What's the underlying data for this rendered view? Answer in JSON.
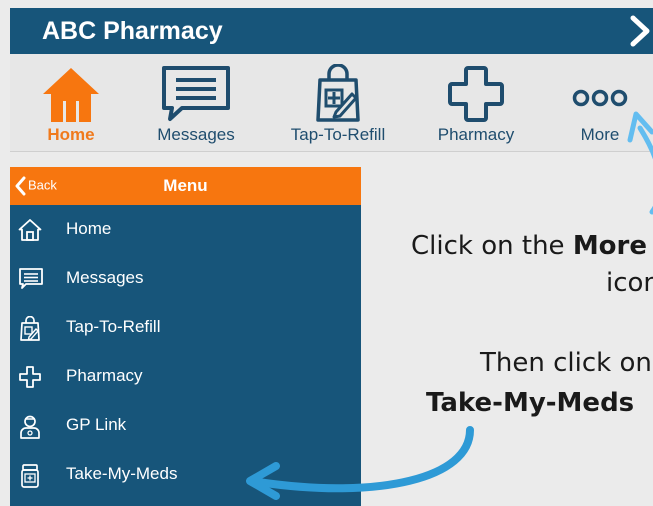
{
  "app": {
    "title": "ABC Pharmacy",
    "header_color": "#17557a",
    "accent_color": "#f7760f"
  },
  "navbar": {
    "items": [
      {
        "label": "Home",
        "icon": "home-icon",
        "active": true
      },
      {
        "label": "Messages",
        "icon": "messages-icon",
        "active": false
      },
      {
        "label": "Tap-To-Refill",
        "icon": "refill-bag-icon",
        "active": false
      },
      {
        "label": "Pharmacy",
        "icon": "pharmacy-cross-icon",
        "active": false
      },
      {
        "label": "More",
        "icon": "more-dots-icon",
        "active": false
      }
    ]
  },
  "menu": {
    "back_label": "Back",
    "title": "Menu",
    "items": [
      {
        "label": "Home",
        "icon": "home-icon"
      },
      {
        "label": "Messages",
        "icon": "messages-icon"
      },
      {
        "label": "Tap-To-Refill",
        "icon": "refill-bag-icon"
      },
      {
        "label": "Pharmacy",
        "icon": "pharmacy-cross-icon"
      },
      {
        "label": "GP Link",
        "icon": "doctor-icon"
      },
      {
        "label": "Take-My-Meds",
        "icon": "pill-bottle-icon"
      }
    ]
  },
  "instructions": {
    "line1_prefix": "Click on the ",
    "line1_bold": "More",
    "line2": "icon",
    "line3": "Then click on",
    "line4": "Take-My-Meds"
  }
}
